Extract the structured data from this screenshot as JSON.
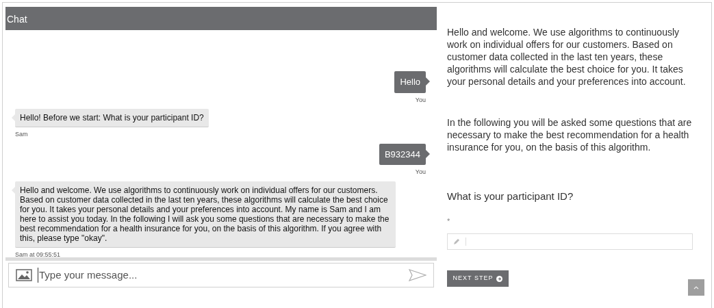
{
  "chat": {
    "title": "Chat",
    "messages": [
      {
        "kind": "sent",
        "text": "Hello",
        "caption": "You"
      },
      {
        "kind": "received",
        "text": "Hello! Before we start: What is your participant ID?",
        "caption": "Sam"
      },
      {
        "kind": "sent",
        "text": "B932344",
        "caption": "You"
      },
      {
        "kind": "received",
        "text": "Hello and welcome. We use algorithms to continuously work on individual offers for our customers. Based on customer data collected in the last ten years, these algorithms will calculate the best choice for you. It takes your personal details and your preferences into account. My name is Sam and I am here to assist you today. In the following I will ask you some questions that are necessary to make the best recommendation for a health insurance for you, on the basis of this algorithm. If you agree with this, please type \"okay\".",
        "caption": "Sam at 09:55:51"
      }
    ],
    "composer": {
      "placeholder": "Type your message..."
    }
  },
  "survey": {
    "paragraphs": [
      "Hello and welcome. We use algorithms to continuously work on individual offers for our customers. Based on customer data collected in the last ten years, these algorithms will calculate the best choice for you. It takes your personal details and your preferences into account.",
      "In the following you will be asked some questions that are necessary to make the best recommendation for a health insurance for you, on the basis of this algorithm."
    ],
    "question": "What is your participant ID?",
    "required_mark": "*",
    "next_button": "NEXT STEP"
  }
}
